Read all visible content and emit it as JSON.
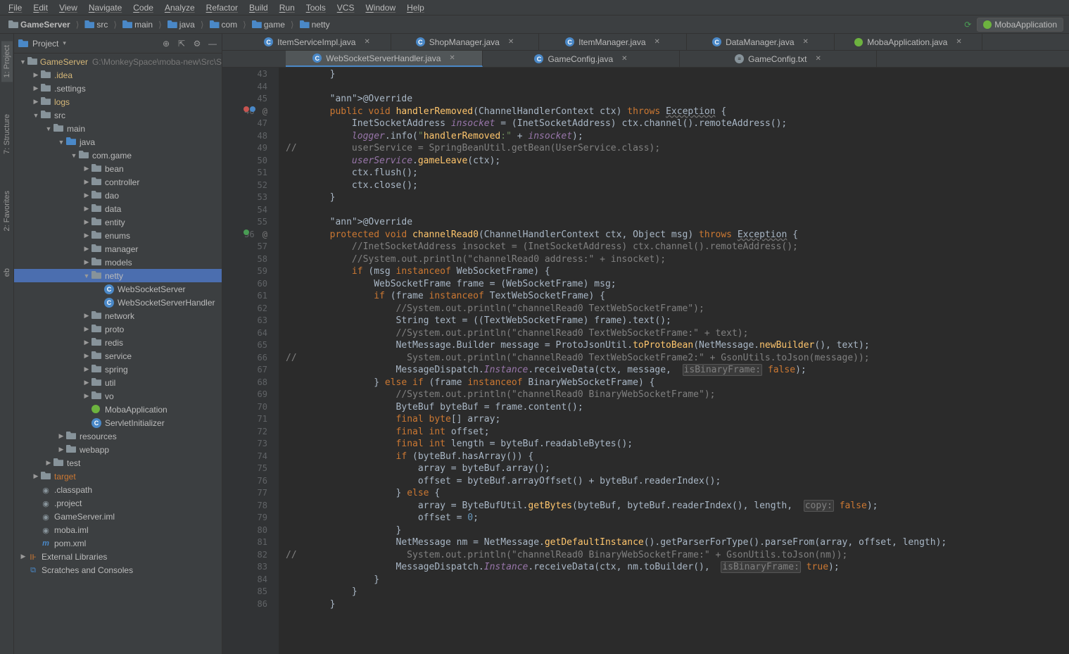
{
  "menu": [
    "File",
    "Edit",
    "View",
    "Navigate",
    "Code",
    "Analyze",
    "Refactor",
    "Build",
    "Run",
    "Tools",
    "VCS",
    "Window",
    "Help"
  ],
  "breadcrumbs": [
    {
      "label": "GameServer",
      "icon": "folder"
    },
    {
      "label": "src",
      "icon": "folder-blue"
    },
    {
      "label": "main",
      "icon": "folder-blue"
    },
    {
      "label": "java",
      "icon": "folder-blue"
    },
    {
      "label": "com",
      "icon": "folder-blue"
    },
    {
      "label": "game",
      "icon": "folder-blue"
    },
    {
      "label": "netty",
      "icon": "folder-blue"
    }
  ],
  "run_config": "MobaApplication",
  "panel": {
    "title": "Project"
  },
  "left_tool": [
    {
      "label": "1: Project",
      "active": true
    },
    {
      "label": "7: Structure",
      "active": false
    },
    {
      "label": "2: Favorites",
      "active": false
    },
    {
      "label": "eb",
      "active": false
    }
  ],
  "tree": [
    {
      "indent": 0,
      "arrow": "▼",
      "icon": "folder",
      "label": "GameServer",
      "hint": "G:\\MonkeySpace\\moba-new\\Src\\Sc",
      "highlight": true
    },
    {
      "indent": 1,
      "arrow": "▶",
      "icon": "folder",
      "label": ".idea",
      "highlight": true
    },
    {
      "indent": 1,
      "arrow": "▶",
      "icon": "folder",
      "label": ".settings"
    },
    {
      "indent": 1,
      "arrow": "▶",
      "icon": "folder",
      "label": "logs",
      "highlight": true
    },
    {
      "indent": 1,
      "arrow": "▼",
      "icon": "folder",
      "label": "src"
    },
    {
      "indent": 2,
      "arrow": "▼",
      "icon": "folder",
      "label": "main"
    },
    {
      "indent": 3,
      "arrow": "▼",
      "icon": "folder-blue",
      "label": "java"
    },
    {
      "indent": 4,
      "arrow": "▼",
      "icon": "folder",
      "label": "com.game"
    },
    {
      "indent": 5,
      "arrow": "▶",
      "icon": "folder",
      "label": "bean"
    },
    {
      "indent": 5,
      "arrow": "▶",
      "icon": "folder",
      "label": "controller"
    },
    {
      "indent": 5,
      "arrow": "▶",
      "icon": "folder",
      "label": "dao"
    },
    {
      "indent": 5,
      "arrow": "▶",
      "icon": "folder",
      "label": "data"
    },
    {
      "indent": 5,
      "arrow": "▶",
      "icon": "folder",
      "label": "entity"
    },
    {
      "indent": 5,
      "arrow": "▶",
      "icon": "folder",
      "label": "enums"
    },
    {
      "indent": 5,
      "arrow": "▶",
      "icon": "folder",
      "label": "manager"
    },
    {
      "indent": 5,
      "arrow": "▶",
      "icon": "folder",
      "label": "models"
    },
    {
      "indent": 5,
      "arrow": "▼",
      "icon": "folder",
      "label": "netty",
      "selected": true
    },
    {
      "indent": 6,
      "arrow": "",
      "icon": "class",
      "label": "WebSocketServer"
    },
    {
      "indent": 6,
      "arrow": "",
      "icon": "class",
      "label": "WebSocketServerHandler"
    },
    {
      "indent": 5,
      "arrow": "▶",
      "icon": "folder",
      "label": "network"
    },
    {
      "indent": 5,
      "arrow": "▶",
      "icon": "folder",
      "label": "proto"
    },
    {
      "indent": 5,
      "arrow": "▶",
      "icon": "folder",
      "label": "redis"
    },
    {
      "indent": 5,
      "arrow": "▶",
      "icon": "folder",
      "label": "service"
    },
    {
      "indent": 5,
      "arrow": "▶",
      "icon": "folder",
      "label": "spring"
    },
    {
      "indent": 5,
      "arrow": "▶",
      "icon": "folder",
      "label": "util"
    },
    {
      "indent": 5,
      "arrow": "▶",
      "icon": "folder",
      "label": "vo"
    },
    {
      "indent": 5,
      "arrow": "",
      "icon": "spring",
      "label": "MobaApplication"
    },
    {
      "indent": 5,
      "arrow": "",
      "icon": "class",
      "label": "ServletInitializer"
    },
    {
      "indent": 3,
      "arrow": "▶",
      "icon": "folder",
      "label": "resources"
    },
    {
      "indent": 3,
      "arrow": "▶",
      "icon": "folder",
      "label": "webapp"
    },
    {
      "indent": 2,
      "arrow": "▶",
      "icon": "folder",
      "label": "test"
    },
    {
      "indent": 1,
      "arrow": "▶",
      "icon": "folder",
      "label": "target",
      "orange": true
    },
    {
      "indent": 1,
      "arrow": "",
      "icon": "file",
      "label": ".classpath"
    },
    {
      "indent": 1,
      "arrow": "",
      "icon": "file",
      "label": ".project"
    },
    {
      "indent": 1,
      "arrow": "",
      "icon": "file",
      "label": "GameServer.iml"
    },
    {
      "indent": 1,
      "arrow": "",
      "icon": "file",
      "label": "moba.iml"
    },
    {
      "indent": 1,
      "arrow": "",
      "icon": "maven",
      "label": "pom.xml"
    },
    {
      "indent": 0,
      "arrow": "▶",
      "icon": "lib",
      "label": "External Libraries"
    },
    {
      "indent": 0,
      "arrow": "",
      "icon": "scratch",
      "label": "Scratches and Consoles"
    }
  ],
  "tabs_row1": [
    {
      "label": "ItemServiceImpl.java",
      "icon": "c"
    },
    {
      "label": "ShopManager.java",
      "icon": "c"
    },
    {
      "label": "ItemManager.java",
      "icon": "c"
    },
    {
      "label": "DataManager.java",
      "icon": "c"
    },
    {
      "label": "MobaApplication.java",
      "icon": "spring"
    }
  ],
  "tabs_row2": [
    {
      "label": "WebSocketServerHandler.java",
      "icon": "c",
      "active": true
    },
    {
      "label": "GameConfig.java",
      "icon": "c"
    },
    {
      "label": "GameConfig.txt",
      "icon": "txt"
    }
  ],
  "line_start": 43,
  "line_end": 86,
  "marks": {
    "46": [
      "red",
      "blue"
    ],
    "56": [
      "green"
    ]
  },
  "code": [
    "        }",
    "",
    "        @Override",
    "        public void handlerRemoved(ChannelHandlerContext ctx) throws Exception {",
    "            InetSocketAddress insocket = (InetSocketAddress) ctx.channel().remoteAddress();",
    "            logger.info(\"handlerRemoved:\" + insocket);",
    "//          userService = SpringBeanUtil.getBean(UserService.class);",
    "            userService.gameLeave(ctx);",
    "            ctx.flush();",
    "            ctx.close();",
    "        }",
    "",
    "        @Override",
    "        protected void channelRead0(ChannelHandlerContext ctx, Object msg) throws Exception {",
    "            //InetSocketAddress insocket = (InetSocketAddress) ctx.channel().remoteAddress();",
    "            //System.out.println(\"channelRead0 address:\" + insocket);",
    "            if (msg instanceof WebSocketFrame) {",
    "                WebSocketFrame frame = (WebSocketFrame) msg;",
    "                if (frame instanceof TextWebSocketFrame) {",
    "                    //System.out.println(\"channelRead0 TextWebSocketFrame\");",
    "                    String text = ((TextWebSocketFrame) frame).text();",
    "                    //System.out.println(\"channelRead0 TextWebSocketFrame:\" + text);",
    "                    NetMessage.Builder message = ProtoJsonUtil.toProtoBean(NetMessage.newBuilder(), text);",
    "//                    System.out.println(\"channelRead0 TextWebSocketFrame2:\" + GsonUtils.toJson(message));",
    "                    MessageDispatch.Instance.receiveData(ctx, message,  isBinaryFrame: false);",
    "                } else if (frame instanceof BinaryWebSocketFrame) {",
    "                    //System.out.println(\"channelRead0 BinaryWebSocketFrame\");",
    "                    ByteBuf byteBuf = frame.content();",
    "                    final byte[] array;",
    "                    final int offset;",
    "                    final int length = byteBuf.readableBytes();",
    "                    if (byteBuf.hasArray()) {",
    "                        array = byteBuf.array();",
    "                        offset = byteBuf.arrayOffset() + byteBuf.readerIndex();",
    "                    } else {",
    "                        array = ByteBufUtil.getBytes(byteBuf, byteBuf.readerIndex(), length,  copy: false);",
    "                        offset = 0;",
    "                    }",
    "                    NetMessage nm = NetMessage.getDefaultInstance().getParserForType().parseFrom(array, offset, length);",
    "//                    System.out.println(\"channelRead0 BinaryWebSocketFrame:\" + GsonUtils.toJson(nm));",
    "                    MessageDispatch.Instance.receiveData(ctx, nm.toBuilder(),  isBinaryFrame: true);",
    "                }",
    "            }",
    "        }"
  ]
}
